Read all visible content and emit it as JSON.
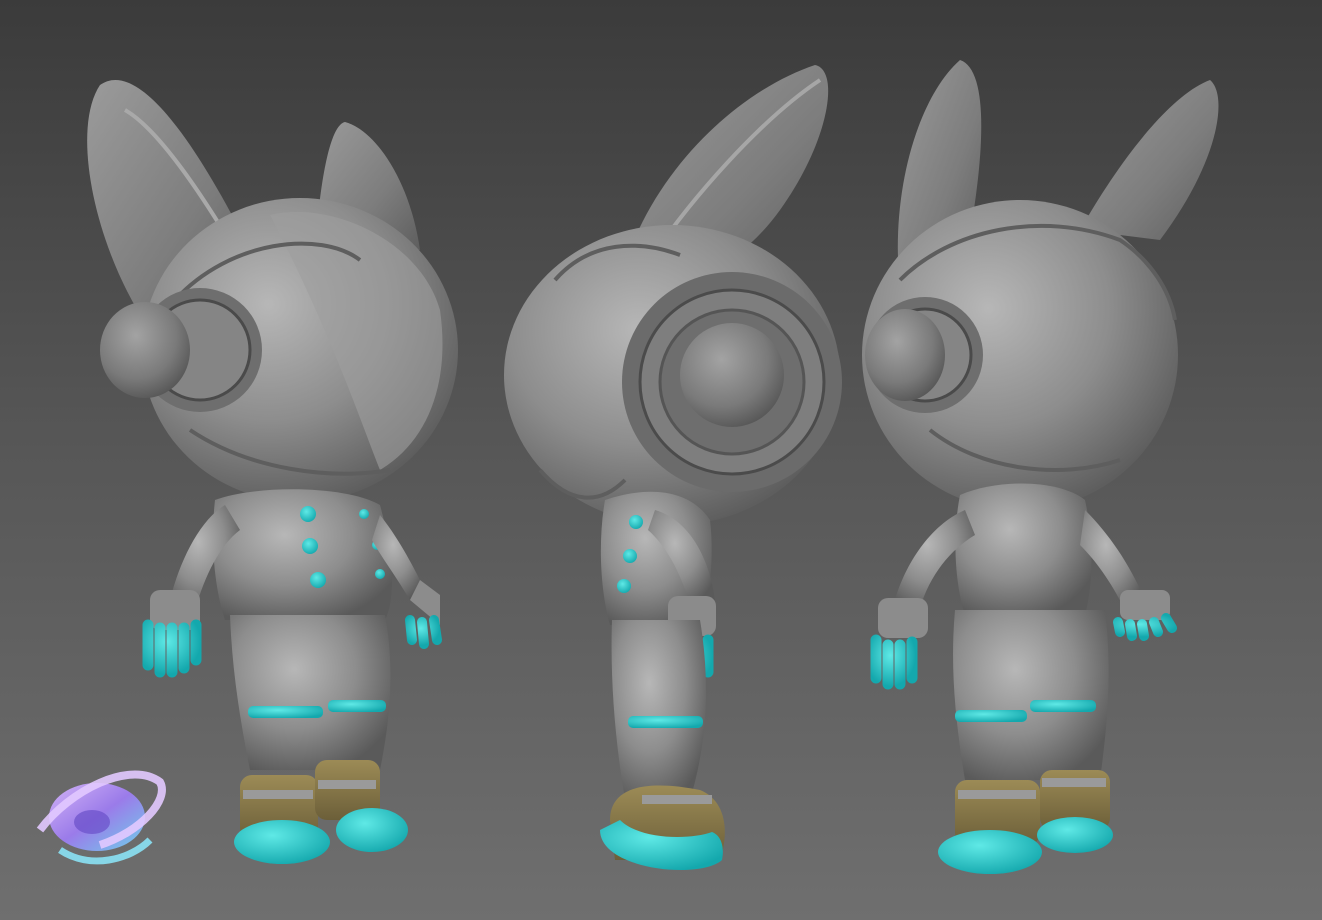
{
  "scene": {
    "subject": "3d-sculpt-astronaut-bunny-turnaround",
    "views": [
      "three-quarter-front",
      "side-profile",
      "three-quarter-back"
    ],
    "colors": {
      "background_top": "#3b3b3b",
      "background_bottom": "#6f6f6f",
      "clay_gray": "#8a8a8a",
      "accent_teal": "#22c8c8",
      "boot_olive": "#8a7a4c",
      "logo_purple": "#b59bf0",
      "logo_cyan": "#7ad8f0"
    },
    "logo_icon": "planet-ring-logo"
  }
}
